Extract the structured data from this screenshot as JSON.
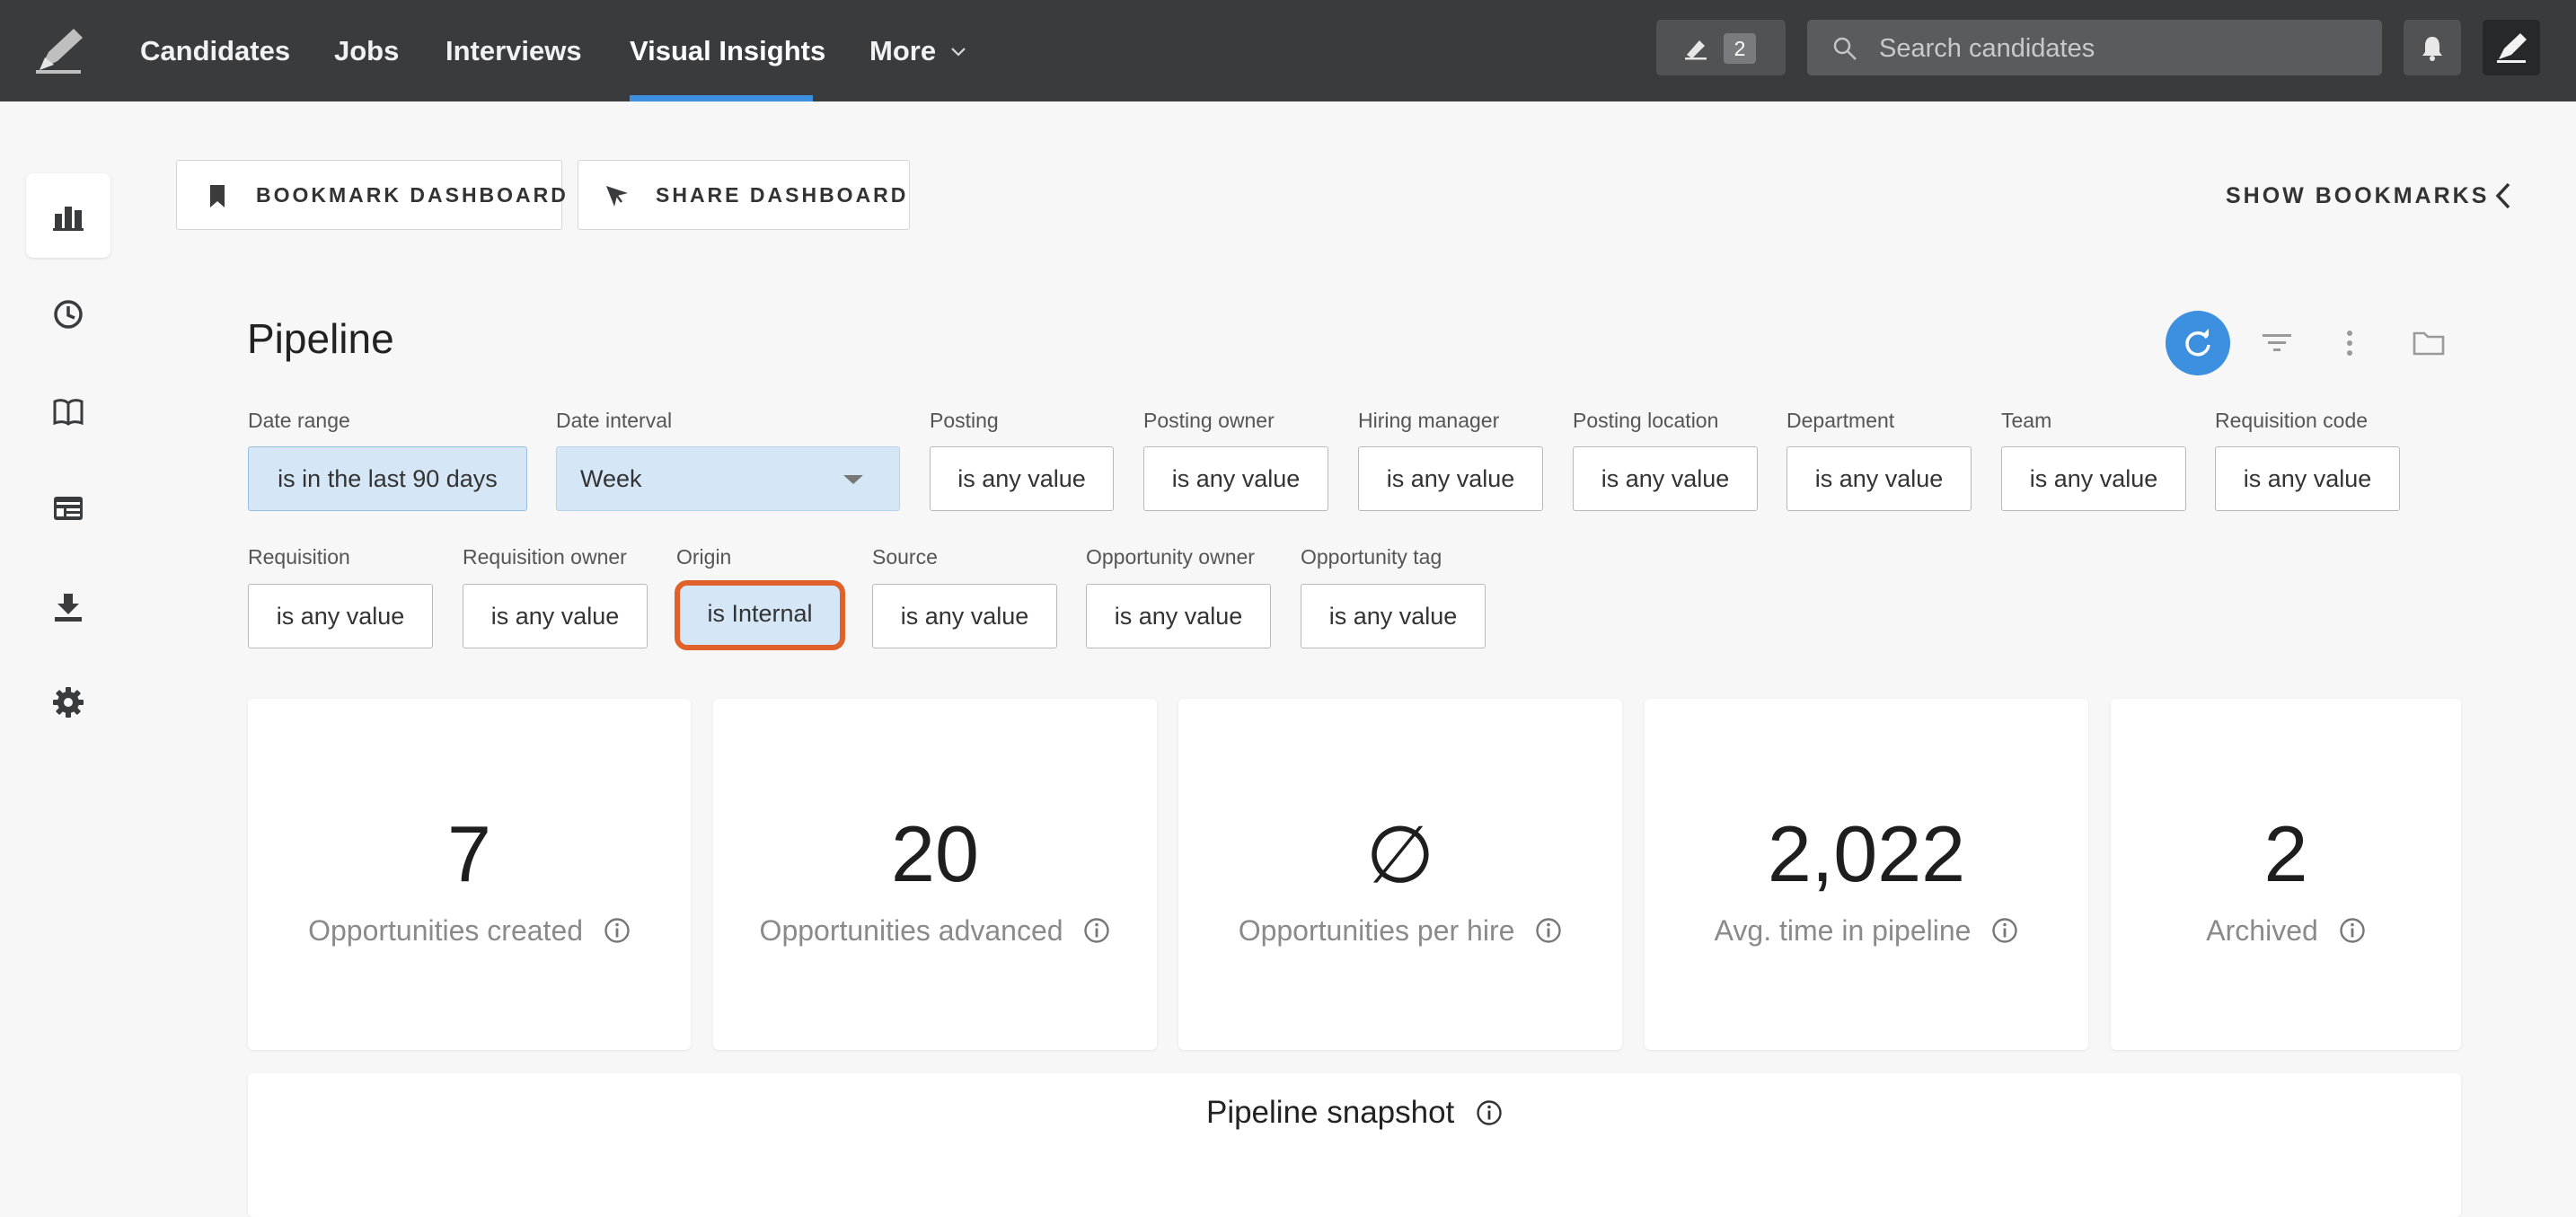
{
  "nav": {
    "items": [
      {
        "label": "Candidates"
      },
      {
        "label": "Jobs"
      },
      {
        "label": "Interviews"
      },
      {
        "label": "Visual Insights"
      },
      {
        "label": "More"
      }
    ],
    "edit_count": "2",
    "search_placeholder": "Search candidates"
  },
  "toolbar": {
    "bookmark_label": "BOOKMARK DASHBOARD",
    "share_label": "SHARE DASHBOARD",
    "show_bookmarks_label": "SHOW BOOKMARKS"
  },
  "pipeline": {
    "title": "Pipeline",
    "filters": {
      "date_range": {
        "label": "Date range",
        "value": "is in the last 90 days"
      },
      "date_interval": {
        "label": "Date interval",
        "value": "Week"
      },
      "posting": {
        "label": "Posting",
        "value": "is any value"
      },
      "posting_owner": {
        "label": "Posting owner",
        "value": "is any value"
      },
      "hiring_manager": {
        "label": "Hiring manager",
        "value": "is any value"
      },
      "posting_location": {
        "label": "Posting location",
        "value": "is any value"
      },
      "department": {
        "label": "Department",
        "value": "is any value"
      },
      "team": {
        "label": "Team",
        "value": "is any value"
      },
      "requisition_code": {
        "label": "Requisition code",
        "value": "is any value"
      },
      "requisition": {
        "label": "Requisition",
        "value": "is any value"
      },
      "requisition_owner": {
        "label": "Requisition owner",
        "value": "is any value"
      },
      "origin": {
        "label": "Origin",
        "value": "is Internal"
      },
      "source": {
        "label": "Source",
        "value": "is any value"
      },
      "opportunity_owner": {
        "label": "Opportunity owner",
        "value": "is any value"
      },
      "opportunity_tag": {
        "label": "Opportunity tag",
        "value": "is any value"
      }
    },
    "metrics": [
      {
        "value": "7",
        "caption": "Opportunities created"
      },
      {
        "value": "20",
        "caption": "Opportunities advanced"
      },
      {
        "value": "∅",
        "caption": "Opportunities per hire"
      },
      {
        "value": "2,022",
        "caption": "Avg. time in pipeline"
      },
      {
        "value": "2",
        "caption": "Archived"
      }
    ],
    "snapshot_title": "Pipeline snapshot"
  },
  "colors": {
    "topbar": "#3a3b3d",
    "accent": "#3d8fe0",
    "highlight": "#e0622a",
    "selected_filter": "#d5e6f7"
  }
}
